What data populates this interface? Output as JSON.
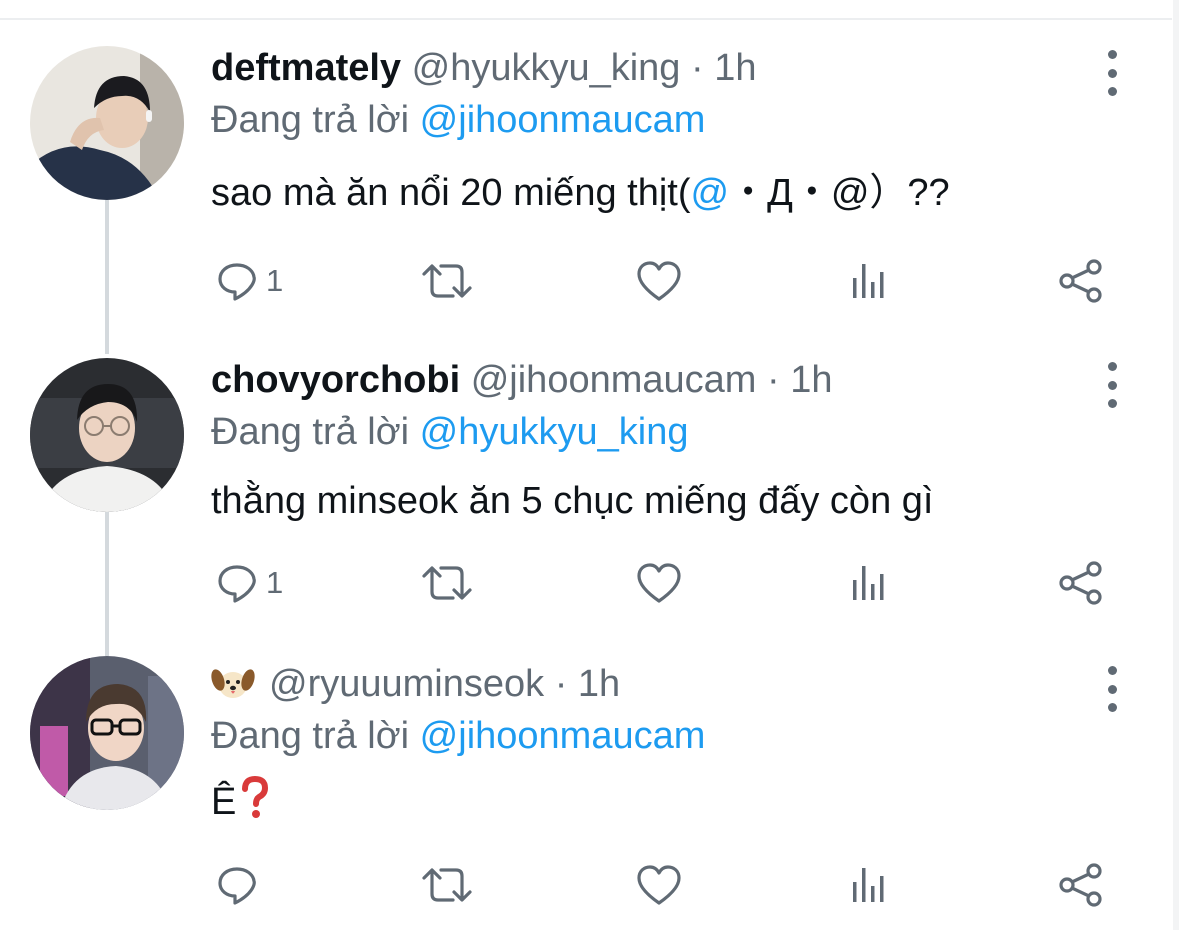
{
  "tweets": [
    {
      "display_name": "deftmately",
      "handle": "@hyukkyu_king",
      "separator": "·",
      "time": "1h",
      "reply_prefix": "Đang trả lời",
      "reply_to": "@jihoonmaucam",
      "text_main": "sao mà ăn nổi 20 miếng thịt(",
      "text_at": "@",
      "text_rest": "・Д・@）??",
      "reply_count": "1",
      "avatar_icon": "person-avatar"
    },
    {
      "display_name": "chovyorchobi",
      "handle": "@jihoonmaucam",
      "separator": "·",
      "time": "1h",
      "reply_prefix": "Đang trả lời",
      "reply_to": "@hyukkyu_king",
      "text_main": "thằng minseok ăn 5 chục miếng đấy còn gì",
      "reply_count": "1",
      "avatar_icon": "person-avatar"
    },
    {
      "display_name_icon": "dog-face-emoji",
      "handle": "@ryuuuminseok",
      "separator": "·",
      "time": "1h",
      "reply_prefix": "Đang trả lời",
      "reply_to": "@jihoonmaucam",
      "text_main": "Ê",
      "text_emoji": "question-mark-emoji",
      "reply_count": "",
      "avatar_icon": "person-avatar"
    }
  ],
  "icons": {
    "reply": "reply-icon",
    "retweet": "retweet-icon",
    "like": "heart-icon",
    "analytics": "analytics-icon",
    "share": "share-icon",
    "more": "more-vertical-icon"
  },
  "colors": {
    "mention": "#1d9bf0",
    "secondary_text": "#606a74",
    "primary_text": "#0f1419",
    "thread_line": "#d4d9dd"
  }
}
